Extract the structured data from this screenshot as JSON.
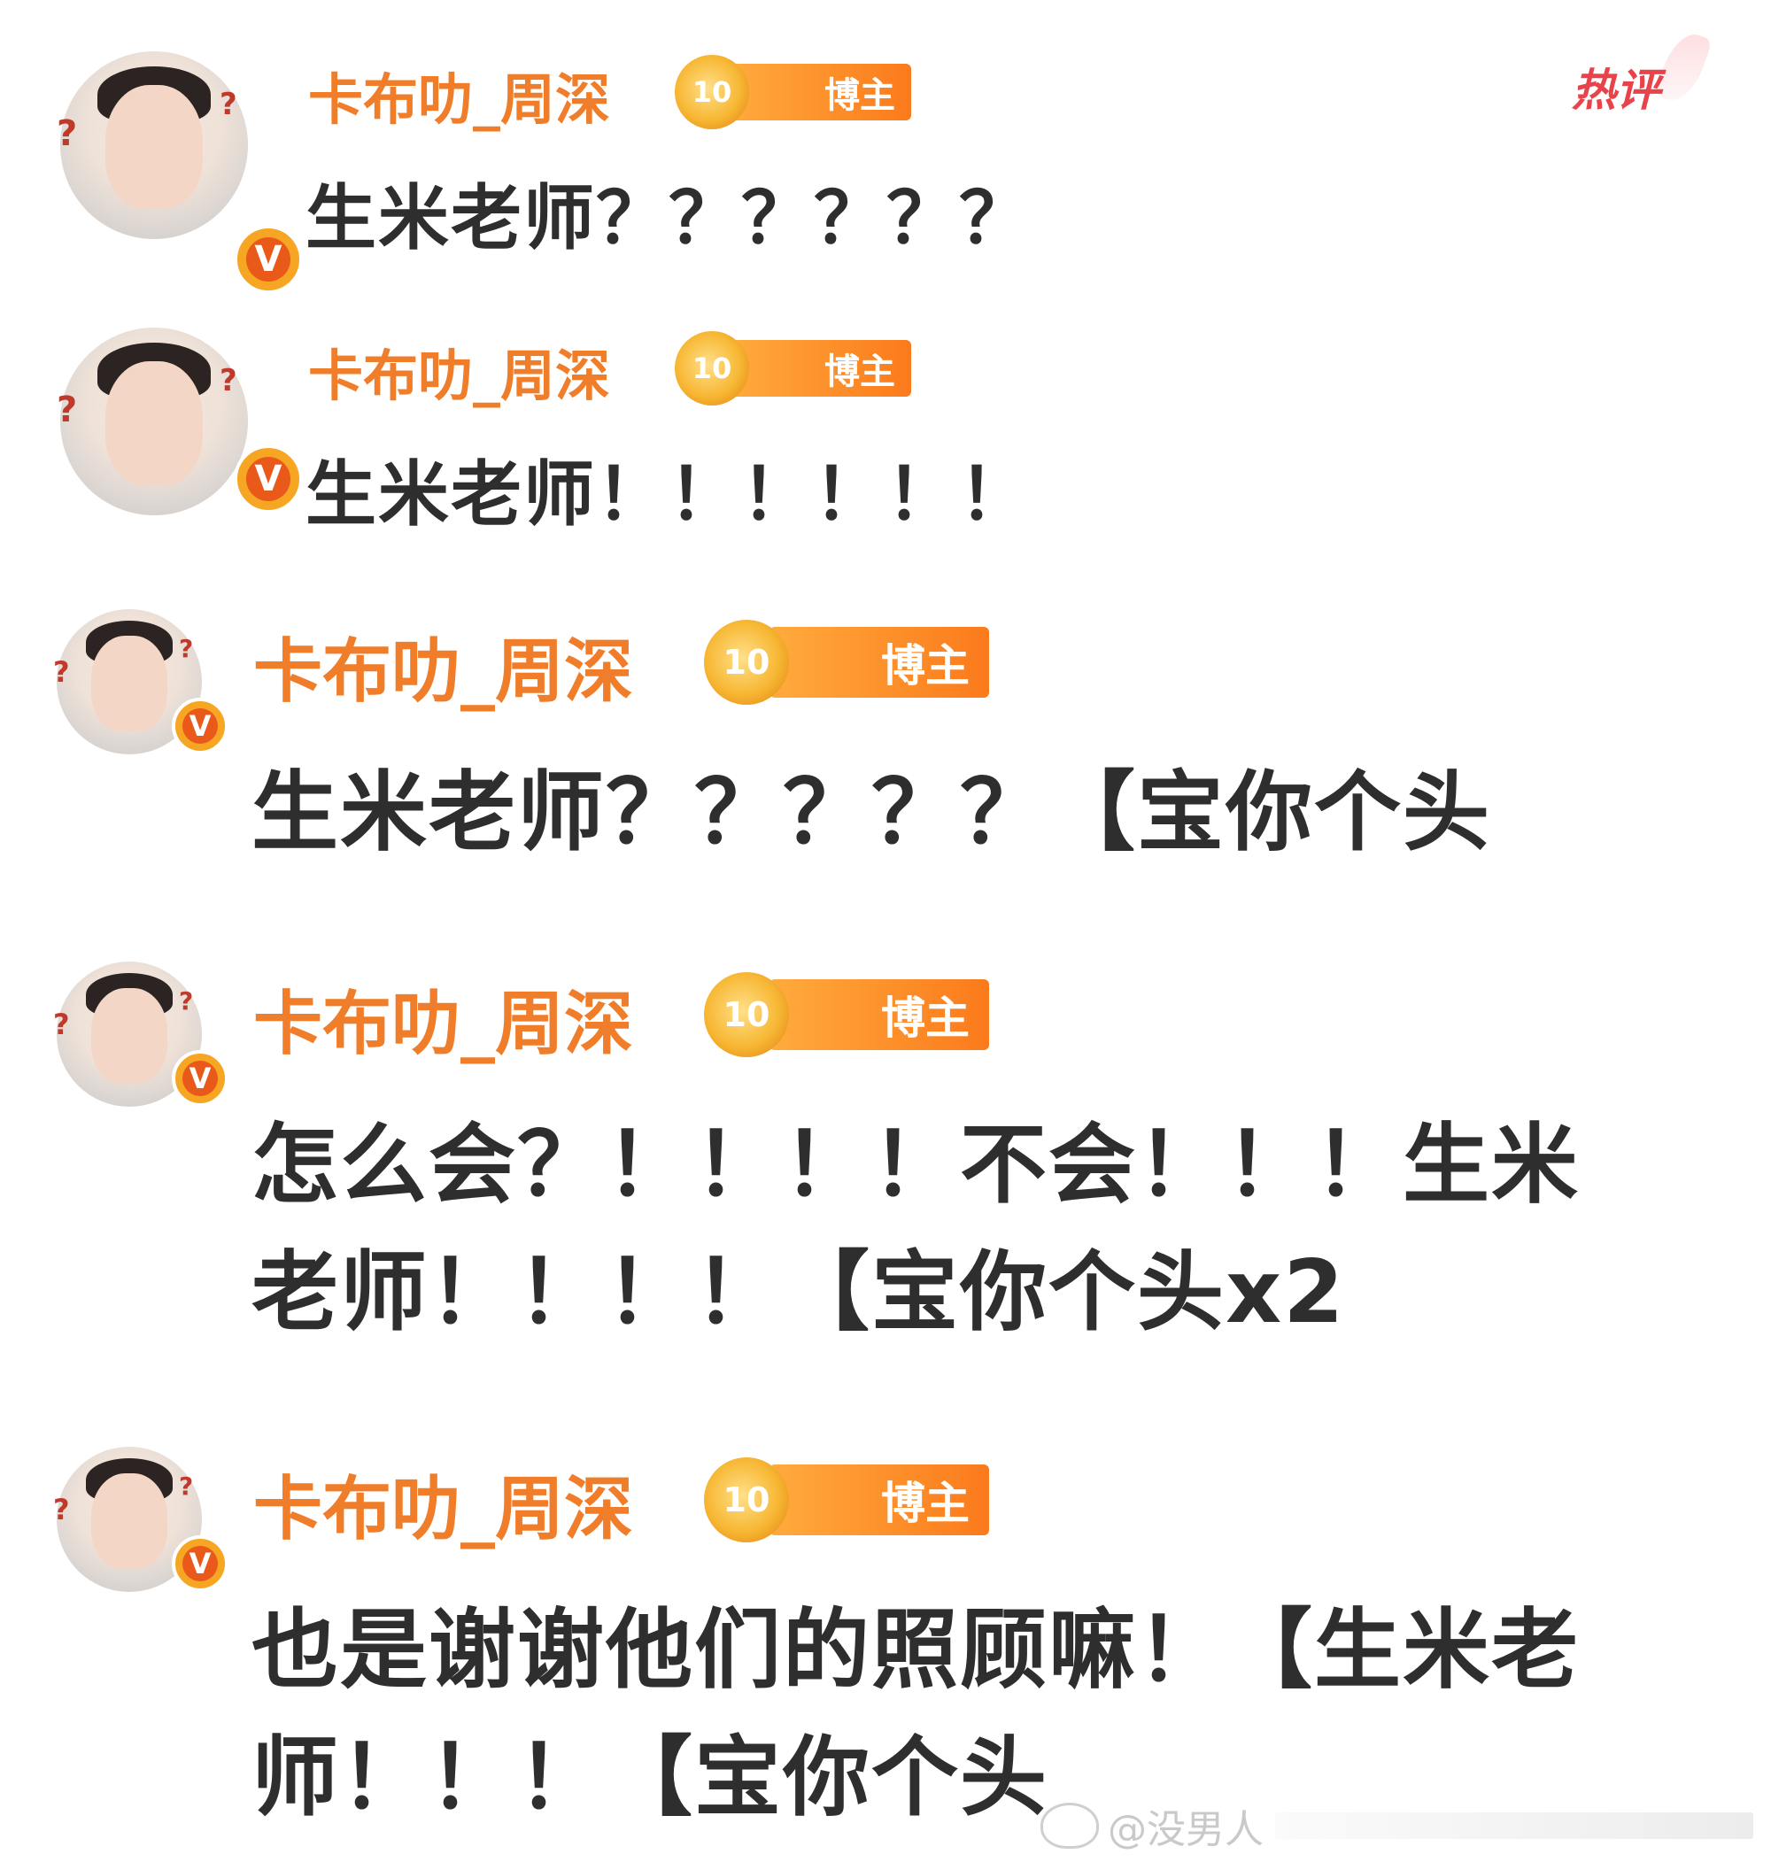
{
  "hot_label": "热评",
  "watermark": "@没男人",
  "badge": {
    "level": "10",
    "label": "博主"
  },
  "comments": [
    {
      "username": "卡布叻_周深",
      "lines": [
        "生米老师？？？？？？"
      ]
    },
    {
      "username": "卡布叻_周深",
      "lines": [
        "生米老师！！！！！！"
      ]
    },
    {
      "username": "卡布叻_周深",
      "lines": [
        "生米老师？？？？？【宝你个头"
      ]
    },
    {
      "username": "卡布叻_周深",
      "lines": [
        "怎么会？！！！！不会！！！生米",
        "老师！！！！【宝你个头x2"
      ]
    },
    {
      "username": "卡布叻_周深",
      "lines": [
        "也是谢谢他们的照顾嘛！【生米老",
        "师！！！【宝你个头"
      ]
    }
  ]
}
